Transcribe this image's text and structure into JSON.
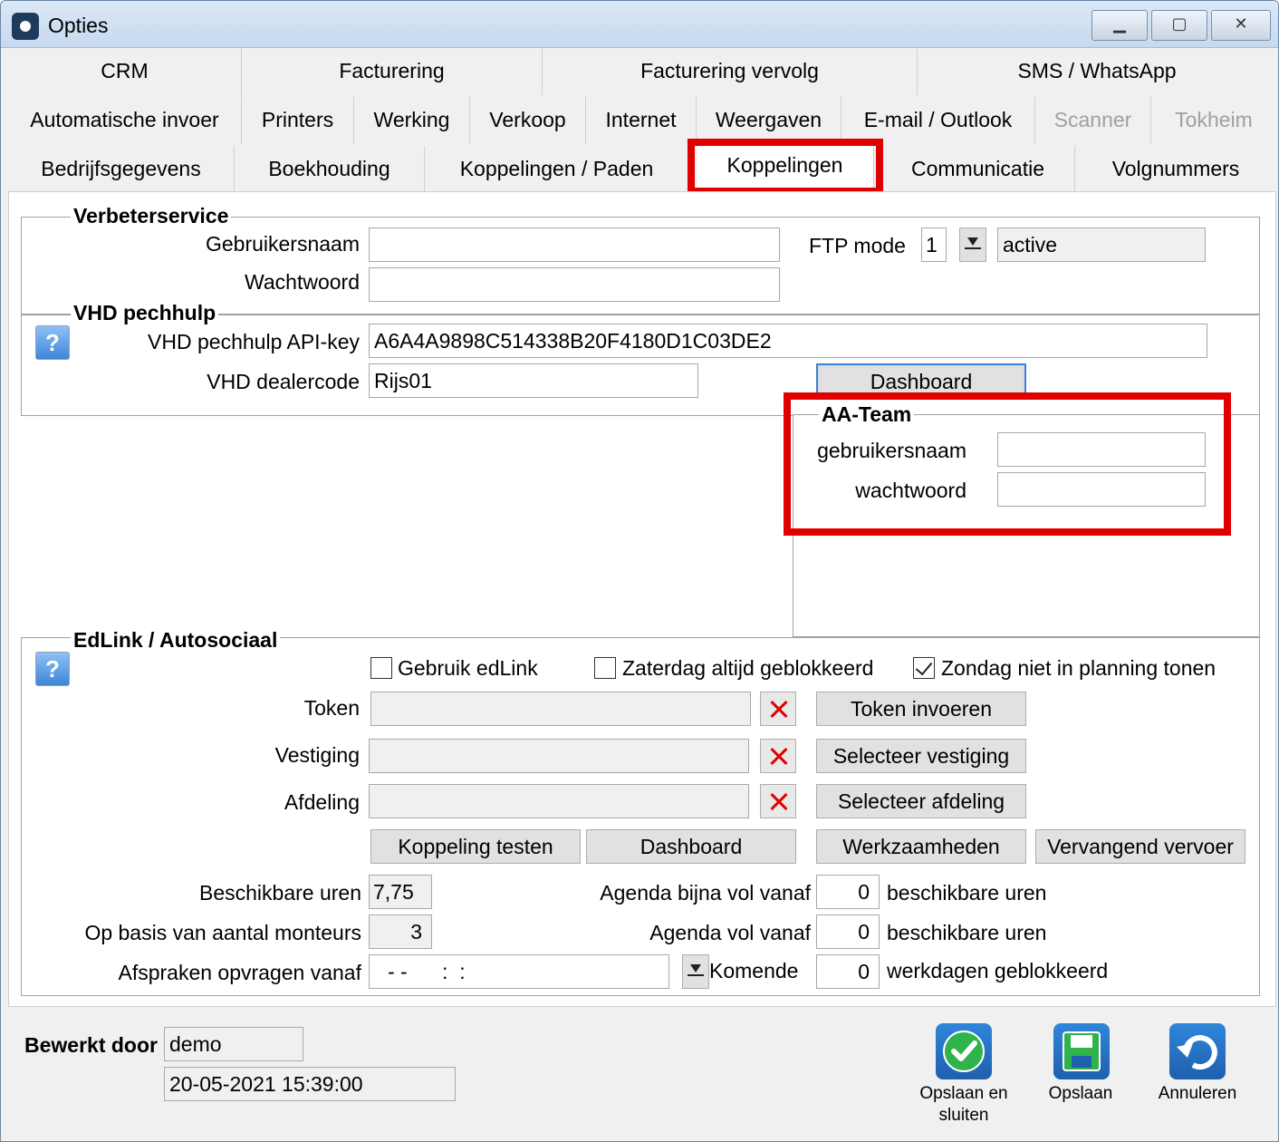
{
  "window": {
    "title": "Opties"
  },
  "tabs": {
    "row1": [
      "CRM",
      "Facturering",
      "Facturering vervolg",
      "SMS / WhatsApp"
    ],
    "row2": [
      "Automatische invoer",
      "Printers",
      "Werking",
      "Verkoop",
      "Internet",
      "Weergaven",
      "E-mail / Outlook",
      "Scanner",
      "Tokheim"
    ],
    "row3": [
      "Bedrijfsgegevens",
      "Boekhouding",
      "Koppelingen / Paden",
      "Koppelingen",
      "Communicatie",
      "Volgnummers"
    ]
  },
  "verbeterservice": {
    "title": "Verbeterservice",
    "username_label": "Gebruikersnaam",
    "username_value": "",
    "password_label": "Wachtwoord",
    "password_value": "",
    "ftp_label": "FTP mode",
    "ftp_value": "1",
    "ftp_mode_text": "active"
  },
  "vhd": {
    "title": "VHD pechhulp",
    "api_label": "VHD pechhulp API-key",
    "api_value": "A6A4A9898C514338B20F4180D1C03DE2",
    "dealer_label": "VHD dealercode",
    "dealer_value": "Rijs01",
    "dashboard_label": "Dashboard"
  },
  "aa_team": {
    "title": "AA-Team",
    "username_label": "gebruikersnaam",
    "username_value": "",
    "password_label": "wachtwoord",
    "password_value": ""
  },
  "edlink": {
    "title": "EdLink / Autosociaal",
    "chk_edlink": "Gebruik edLink",
    "chk_zaterdag": "Zaterdag altijd geblokkeerd",
    "chk_zondag": "Zondag niet in planning tonen",
    "token_label": "Token",
    "token_btn": "Token invoeren",
    "vestiging_label": "Vestiging",
    "vestiging_btn": "Selecteer vestiging",
    "afdeling_label": "Afdeling",
    "afdeling_btn": "Selecteer afdeling",
    "test_btn": "Koppeling testen",
    "dashboard_btn": "Dashboard",
    "werkzaamheden_btn": "Werkzaamheden",
    "vervangend_btn": "Vervangend vervoer",
    "beschikbare_uren_label": "Beschikbare uren",
    "beschikbare_uren_value": "7,75",
    "monteurs_label": "Op basis van aantal monteurs",
    "monteurs_value": "3",
    "afspraken_label": "Afspraken opvragen vanaf",
    "afspraken_value": "- -      :  :",
    "agenda_bijna_label": "Agenda bijna vol vanaf",
    "agenda_bijna_value": "0",
    "agenda_bijna_suffix": "beschikbare uren",
    "agenda_vol_label": "Agenda vol vanaf",
    "agenda_vol_value": "0",
    "agenda_vol_suffix": "beschikbare uren",
    "komende_label": "Komende",
    "komende_value": "0",
    "komende_suffix": "werkdagen geblokkeerd"
  },
  "footer": {
    "edited_by_label": "Bewerkt door",
    "edited_by_value": "demo",
    "timestamp": "20-05-2021 15:39:00",
    "save_close_label_1": "Opslaan en",
    "save_close_label_2": "sluiten",
    "save_label": "Opslaan",
    "cancel_label": "Annuleren"
  },
  "colors": {
    "highlight": "#e00000",
    "accent": "#3e86da"
  }
}
